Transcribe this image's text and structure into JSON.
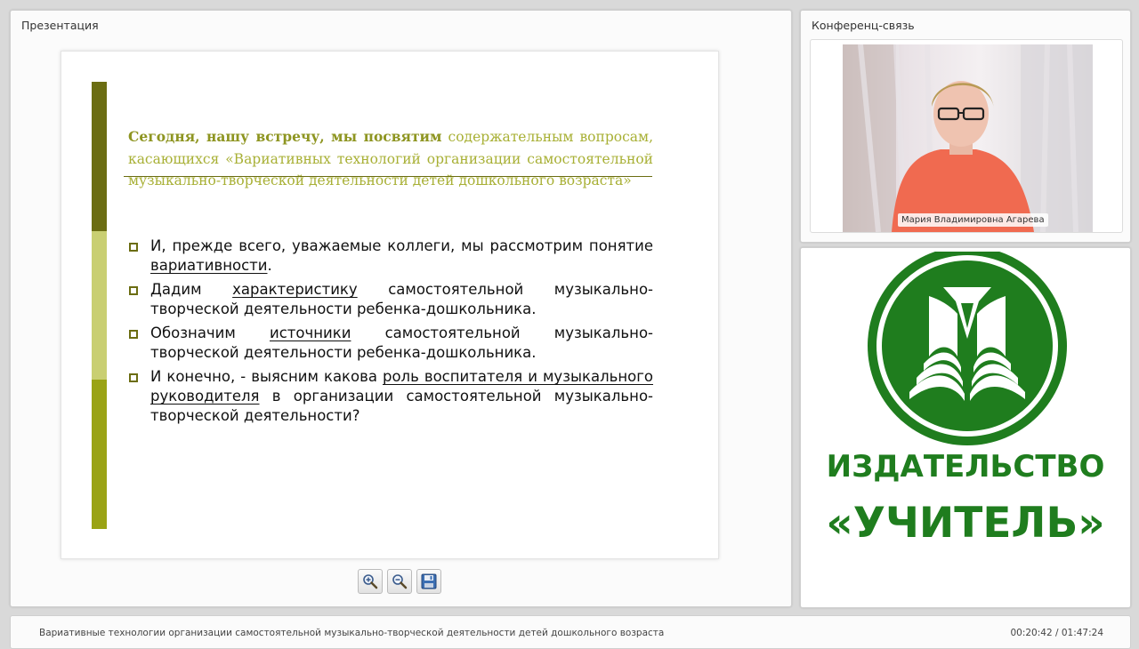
{
  "presentation": {
    "title": "Презентация",
    "slide": {
      "intro_bold": "Сегодня, нашу встречу, мы посвятим",
      "intro_rest": " содержательным вопросам, касающихся «Вариативных технологий организации самостоятельной музыкально-творческой деятельности детей дошкольного возраста»",
      "bullets": [
        {
          "before": "И, прежде всего, уважаемые коллеги, мы рассмотрим понятие ",
          "link": "вариативности",
          "after": "."
        },
        {
          "before": "Дадим ",
          "link": "характеристику",
          "after": " самостоятельной музыкально-творческой деятельности ребенка-дошкольника."
        },
        {
          "before": "Обозначим ",
          "link": "источники",
          "after": " самостоятельной музыкально-творческой деятельности ребенка-дошкольника."
        },
        {
          "before": "И конечно, - выясним какова ",
          "link": "роль воспитателя и музыкального руководителя",
          "after": " в организации самостоятельной музыкально-творческой деятельности?"
        }
      ]
    },
    "toolbar": {
      "zoom_in_icon": "zoom-in-icon",
      "zoom_out_icon": "zoom-out-icon",
      "save_icon": "floppy-disk-icon"
    }
  },
  "conference": {
    "title": "Конференц-связь",
    "participant_name": "Мария Владимировна Агарева"
  },
  "logo": {
    "line1": "ИЗДАТЕЛЬСТВО",
    "line2": "«УЧИТЕЛЬ»",
    "color": "#1f7d1e"
  },
  "footer": {
    "title": "Вариативные технологии организации самостоятельной музыкально-творческой деятельности детей дошкольного возраста",
    "time": "00:20:42 / 01:47:24"
  },
  "colors": {
    "bar_dark": "#6b6d12",
    "bar_light": "#c9cf72",
    "bar_mid": "#9aa315",
    "intro_text": "#a8b035"
  }
}
